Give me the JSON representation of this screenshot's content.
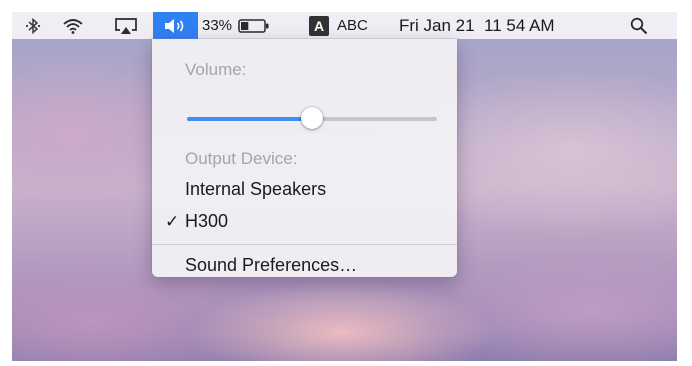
{
  "menubar": {
    "bluetooth_icon": "bluetooth-icon",
    "wifi_icon": "wifi-icon",
    "airplay_icon": "airplay-icon",
    "volume_icon": "volume-icon",
    "battery_percent": "33%",
    "battery_level": 0.33,
    "input_source_letter": "A",
    "input_source_label": "ABC",
    "clock": "Fri Jan 21  11 54 AM",
    "search_icon": "spotlight-search-icon"
  },
  "volume_menu": {
    "volume_header": "Volume:",
    "volume_level": 0.5,
    "output_header": "Output Device:",
    "devices": [
      {
        "label": "Internal Speakers",
        "selected": false
      },
      {
        "label": "H300",
        "selected": true
      }
    ],
    "checkmark": "✓",
    "preferences_label": "Sound Preferences…"
  },
  "colors": {
    "accent": "#2f80f2",
    "slider_fill": "#3e8ff0"
  }
}
